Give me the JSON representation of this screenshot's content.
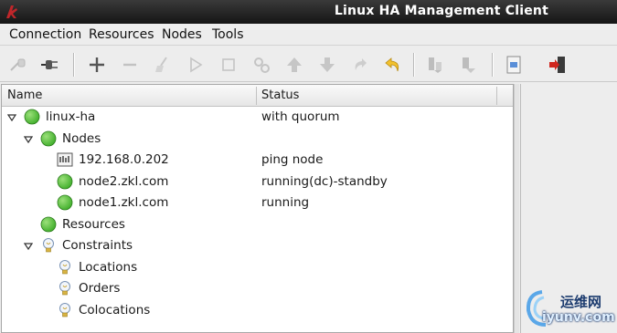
{
  "window": {
    "title": "Linux HA Management Client"
  },
  "menu": [
    "Connection",
    "Resources",
    "Nodes",
    "Tools"
  ],
  "toolbar": {
    "buttons": [
      "disconnect-icon",
      "connect-icon",
      "add-icon",
      "remove-icon",
      "cleanup-icon",
      "start-icon",
      "stop-icon",
      "manage-icon",
      "move-up-icon",
      "move-down-icon",
      "redo-icon",
      "undo-icon",
      "standby-icon",
      "active-icon",
      "view-xml-icon",
      "exit-icon"
    ]
  },
  "tree": {
    "columns": {
      "name": "Name",
      "status": "Status"
    },
    "rows": [
      {
        "name": "linux-ha",
        "status": "with quorum",
        "icon": "green-status-icon",
        "level": 0,
        "expanded": true
      },
      {
        "name": "Nodes",
        "status": "",
        "icon": "green-status-icon",
        "level": 1,
        "expanded": true
      },
      {
        "name": "192.168.0.202",
        "status": "ping node",
        "icon": "ping-node-icon",
        "level": 2
      },
      {
        "name": "node2.zkl.com",
        "status": "running(dc)-standby",
        "icon": "green-status-icon",
        "level": 2
      },
      {
        "name": "node1.zkl.com",
        "status": "running",
        "icon": "green-status-icon",
        "level": 2
      },
      {
        "name": "Resources",
        "status": "",
        "icon": "green-status-icon",
        "level": 1
      },
      {
        "name": "Constraints",
        "status": "",
        "icon": "bulb-icon",
        "level": 1,
        "expanded": true
      },
      {
        "name": "Locations",
        "status": "",
        "icon": "bulb-icon",
        "level": 2
      },
      {
        "name": "Orders",
        "status": "",
        "icon": "bulb-icon",
        "level": 2
      },
      {
        "name": "Colocations",
        "status": "",
        "icon": "bulb-icon",
        "level": 2
      }
    ]
  },
  "watermark": {
    "zh": "运维网",
    "en": "iyunv.com"
  },
  "colors": {
    "status_green": "#3fae2a",
    "titlebar": "#1f1f1f",
    "exit_red": "#d0261e"
  }
}
